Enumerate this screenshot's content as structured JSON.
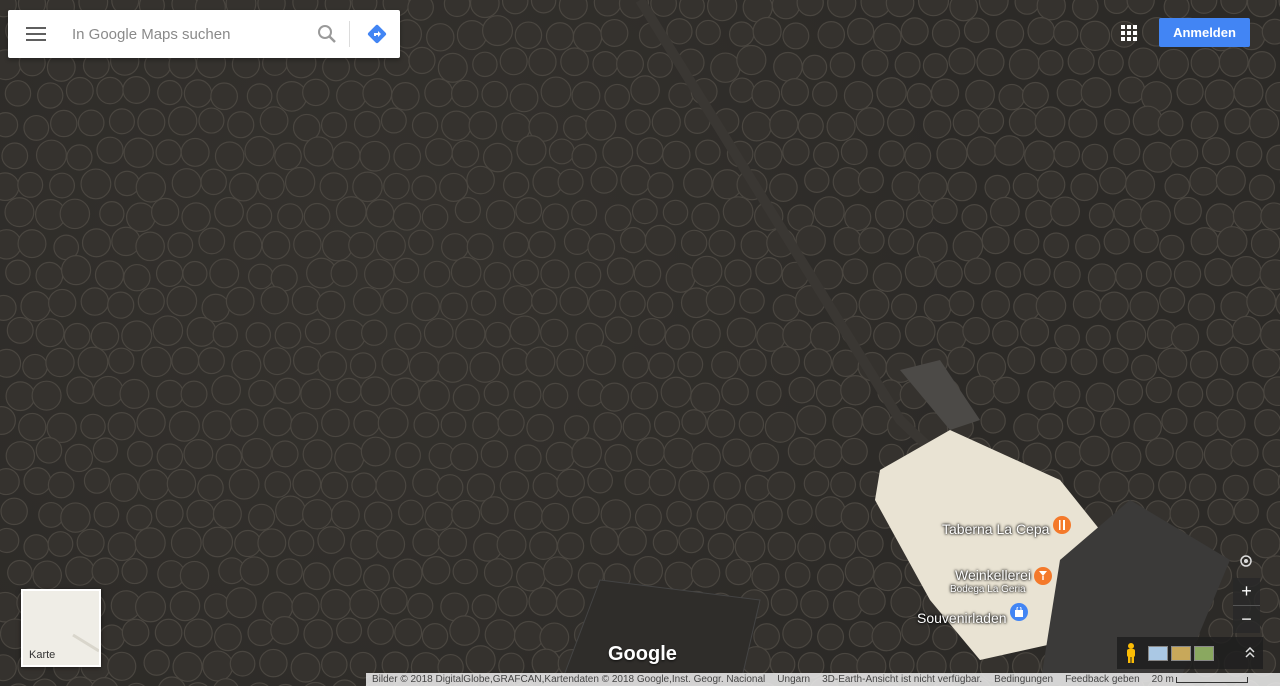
{
  "search": {
    "placeholder": "In Google Maps suchen",
    "menu_icon": "hamburger-menu-icon",
    "search_icon": "search-icon",
    "directions_icon": "directions-icon"
  },
  "header": {
    "apps_icon": "apps-grid-icon",
    "signin_label": "Anmelden"
  },
  "places": [
    {
      "name": "Taberna La Cepa",
      "icon": "restaurant-icon",
      "color": "#f4792a"
    },
    {
      "name": "Weinkellerei",
      "subtitle": "Bodega La Geria",
      "icon": "wine-icon",
      "color": "#f4792a"
    },
    {
      "name": "Souvenirladen",
      "icon": "shopping-bag-icon",
      "color": "#4285f4"
    }
  ],
  "layer_switch": {
    "label": "Karte"
  },
  "brand": {
    "logo_text": "Google"
  },
  "controls": {
    "zoom_in": "+",
    "zoom_out": "−"
  },
  "footer": {
    "attribution": "Bilder © 2018 DigitalGlobe,GRAFCAN,Kartendaten © 2018 Google,Inst. Geogr. Nacional",
    "country": "Ungarn",
    "notice": "3D-Earth-Ansicht ist nicht verfügbar.",
    "terms": "Bedingungen",
    "feedback": "Feedback geben",
    "scale": "20 m"
  },
  "colors": {
    "accent": "#4285f4",
    "map_ground": "#2c2a27"
  }
}
